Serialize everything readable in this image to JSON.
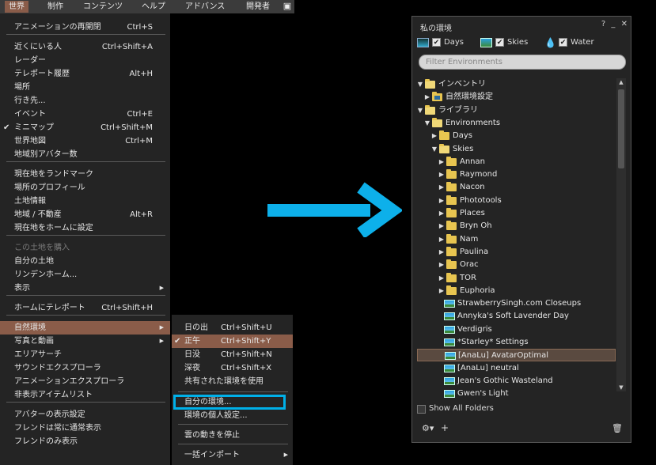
{
  "menubar": {
    "items": [
      "世界",
      "制作",
      "コンテンツ",
      "ヘルプ",
      "アドバンス",
      "開発者"
    ],
    "active_index": 0,
    "right_icon": "media-icon"
  },
  "world_menu": {
    "items": [
      {
        "label": "アニメーションの再開閉",
        "shortcut": "Ctrl+S"
      },
      {
        "label": "近くにいる人",
        "shortcut": "Ctrl+Shift+A"
      },
      {
        "label": "レーダー",
        "shortcut": ""
      },
      {
        "label": "テレポート履歴",
        "shortcut": "Alt+H"
      },
      {
        "label": "場所",
        "shortcut": ""
      },
      {
        "label": "行き先...",
        "shortcut": ""
      },
      {
        "label": "イベント",
        "shortcut": "Ctrl+E"
      },
      {
        "label": "ミニマップ",
        "shortcut": "Ctrl+Shift+M",
        "checked": "✔"
      },
      {
        "label": "世界地図",
        "shortcut": "Ctrl+M"
      },
      {
        "label": "地域別アバター数",
        "shortcut": ""
      },
      {
        "label": "現在地をランドマーク",
        "shortcut": ""
      },
      {
        "label": "場所のプロフィール",
        "shortcut": ""
      },
      {
        "label": "土地情報",
        "shortcut": ""
      },
      {
        "label": "地域 / 不動産",
        "shortcut": "Alt+R"
      },
      {
        "label": "現在地をホームに設定",
        "shortcut": ""
      },
      {
        "label": "この土地を購入",
        "shortcut": ""
      },
      {
        "label": "自分の土地",
        "shortcut": ""
      },
      {
        "label": "リンデンホーム...",
        "shortcut": ""
      },
      {
        "label": "表示",
        "shortcut": ""
      },
      {
        "label": "ホームにテレポート",
        "shortcut": "Ctrl+Shift+H"
      },
      {
        "label": "自然環境",
        "shortcut": ""
      },
      {
        "label": "写真と動画",
        "shortcut": ""
      },
      {
        "label": "エリアサーチ",
        "shortcut": ""
      },
      {
        "label": "サウンドエクスプローラ",
        "shortcut": ""
      },
      {
        "label": "アニメーションエクスプローラ",
        "shortcut": ""
      },
      {
        "label": "非表示アイテムリスト",
        "shortcut": ""
      },
      {
        "label": "アバターの表示設定",
        "shortcut": ""
      },
      {
        "label": "フレンドは常に通常表示",
        "shortcut": ""
      },
      {
        "label": "フレンドのみ表示",
        "shortcut": ""
      }
    ]
  },
  "env_submenu": {
    "items": [
      {
        "label": "日の出",
        "shortcut": "Ctrl+Shift+U"
      },
      {
        "label": "正午",
        "shortcut": "Ctrl+Shift+Y",
        "checked": "✔"
      },
      {
        "label": "日没",
        "shortcut": "Ctrl+Shift+N"
      },
      {
        "label": "深夜",
        "shortcut": "Ctrl+Shift+X"
      },
      {
        "label": "共有された環境を使用",
        "shortcut": ""
      },
      {
        "label": "自分の環境...",
        "shortcut": ""
      },
      {
        "label": "環境の個人設定...",
        "shortcut": ""
      },
      {
        "label": "雲の動きを停止",
        "shortcut": ""
      },
      {
        "label": "一括インポート",
        "shortcut": ""
      }
    ]
  },
  "arrow_color": "#0db0ea",
  "highlight_color": "#00b0e8",
  "floater": {
    "title": "私の環境",
    "buttons": [
      "?",
      "_",
      "✕"
    ],
    "filters": {
      "days": "Days",
      "skies": "Skies",
      "water": "Water"
    },
    "search_placeholder": "Filter Environments",
    "tree": [
      {
        "label": "インベントリ",
        "kind": "folder-open",
        "level": 0,
        "expanded": true
      },
      {
        "label": "自然環境設定",
        "kind": "folder-special",
        "level": 1,
        "expanded": false
      },
      {
        "label": "ライブラリ",
        "kind": "folder-open",
        "level": 0,
        "expanded": true
      },
      {
        "label": "Environments",
        "kind": "folder-open",
        "level": 1,
        "expanded": true
      },
      {
        "label": "Days",
        "kind": "folder",
        "level": 2,
        "expanded": false
      },
      {
        "label": "Skies",
        "kind": "folder-open",
        "level": 2,
        "expanded": true
      },
      {
        "label": "Annan",
        "kind": "folder",
        "level": 3
      },
      {
        "label": "Raymond",
        "kind": "folder",
        "level": 3
      },
      {
        "label": "Nacon",
        "kind": "folder",
        "level": 3
      },
      {
        "label": "Phototools",
        "kind": "folder",
        "level": 3
      },
      {
        "label": "Places",
        "kind": "folder",
        "level": 3
      },
      {
        "label": "Bryn Oh",
        "kind": "folder",
        "level": 3
      },
      {
        "label": "Nam",
        "kind": "folder",
        "level": 3
      },
      {
        "label": "Paulina",
        "kind": "folder",
        "level": 3
      },
      {
        "label": "Orac",
        "kind": "folder",
        "level": 3
      },
      {
        "label": "TOR",
        "kind": "folder",
        "level": 3
      },
      {
        "label": "Euphoria",
        "kind": "folder",
        "level": 3
      },
      {
        "label": "StrawberrySingh.com Closeups",
        "kind": "sky",
        "level": 3
      },
      {
        "label": "Annyka's Soft Lavender Day",
        "kind": "sky",
        "level": 3
      },
      {
        "label": "Verdigris",
        "kind": "sky",
        "level": 3
      },
      {
        "label": "*Starley* Settings",
        "kind": "sky",
        "level": 3
      },
      {
        "label": "[AnaLu] AvatarOptimal",
        "kind": "sky",
        "level": 3,
        "selected": true
      },
      {
        "label": "[AnaLu] neutral",
        "kind": "sky",
        "level": 3
      },
      {
        "label": "Jean's Gothic Wasteland",
        "kind": "sky",
        "level": 3
      },
      {
        "label": "Gwen's Light",
        "kind": "sky",
        "level": 3
      }
    ],
    "show_all_folders": "Show All Folders"
  }
}
